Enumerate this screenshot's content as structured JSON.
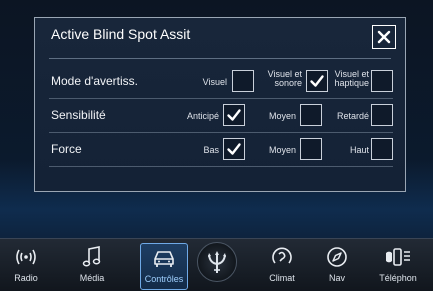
{
  "dialog": {
    "title": "Active Blind Spot Assit",
    "close_glyph": "✕"
  },
  "settings": {
    "rows": [
      {
        "label": "Mode d'avertiss.",
        "options": [
          {
            "label_line1": "Visuel",
            "label_line2": "",
            "checked": false
          },
          {
            "label_line1": "Visuel et",
            "label_line2": "sonore",
            "checked": true
          },
          {
            "label_line1": "Visuel et",
            "label_line2": "haptique",
            "checked": false
          }
        ]
      },
      {
        "label": "Sensibilité",
        "options": [
          {
            "label_line1": "Anticipé",
            "label_line2": "",
            "checked": true
          },
          {
            "label_line1": "Moyen",
            "label_line2": "",
            "checked": false
          },
          {
            "label_line1": "Retardé",
            "label_line2": "",
            "checked": false
          }
        ]
      },
      {
        "label": "Force",
        "options": [
          {
            "label_line1": "Bas",
            "label_line2": "",
            "checked": true
          },
          {
            "label_line1": "Moyen",
            "label_line2": "",
            "checked": false
          },
          {
            "label_line1": "Haut",
            "label_line2": "",
            "checked": false
          }
        ]
      }
    ],
    "check_glyph": "✓"
  },
  "nav": {
    "items": [
      {
        "label": "Radio",
        "icon": "radio-icon"
      },
      {
        "label": "Média",
        "icon": "music-note-icon"
      },
      {
        "label": "Contrôles",
        "icon": "car-icon",
        "active": true
      },
      {
        "label": "Climat",
        "icon": "climate-icon"
      },
      {
        "label": "Nav",
        "icon": "compass-icon"
      },
      {
        "label": "Téléphon",
        "icon": "phone-icon"
      }
    ],
    "center_icon": "trident-logo-icon"
  },
  "colors": {
    "accent": "#6fa9e6",
    "background": "#0b1a2d"
  }
}
